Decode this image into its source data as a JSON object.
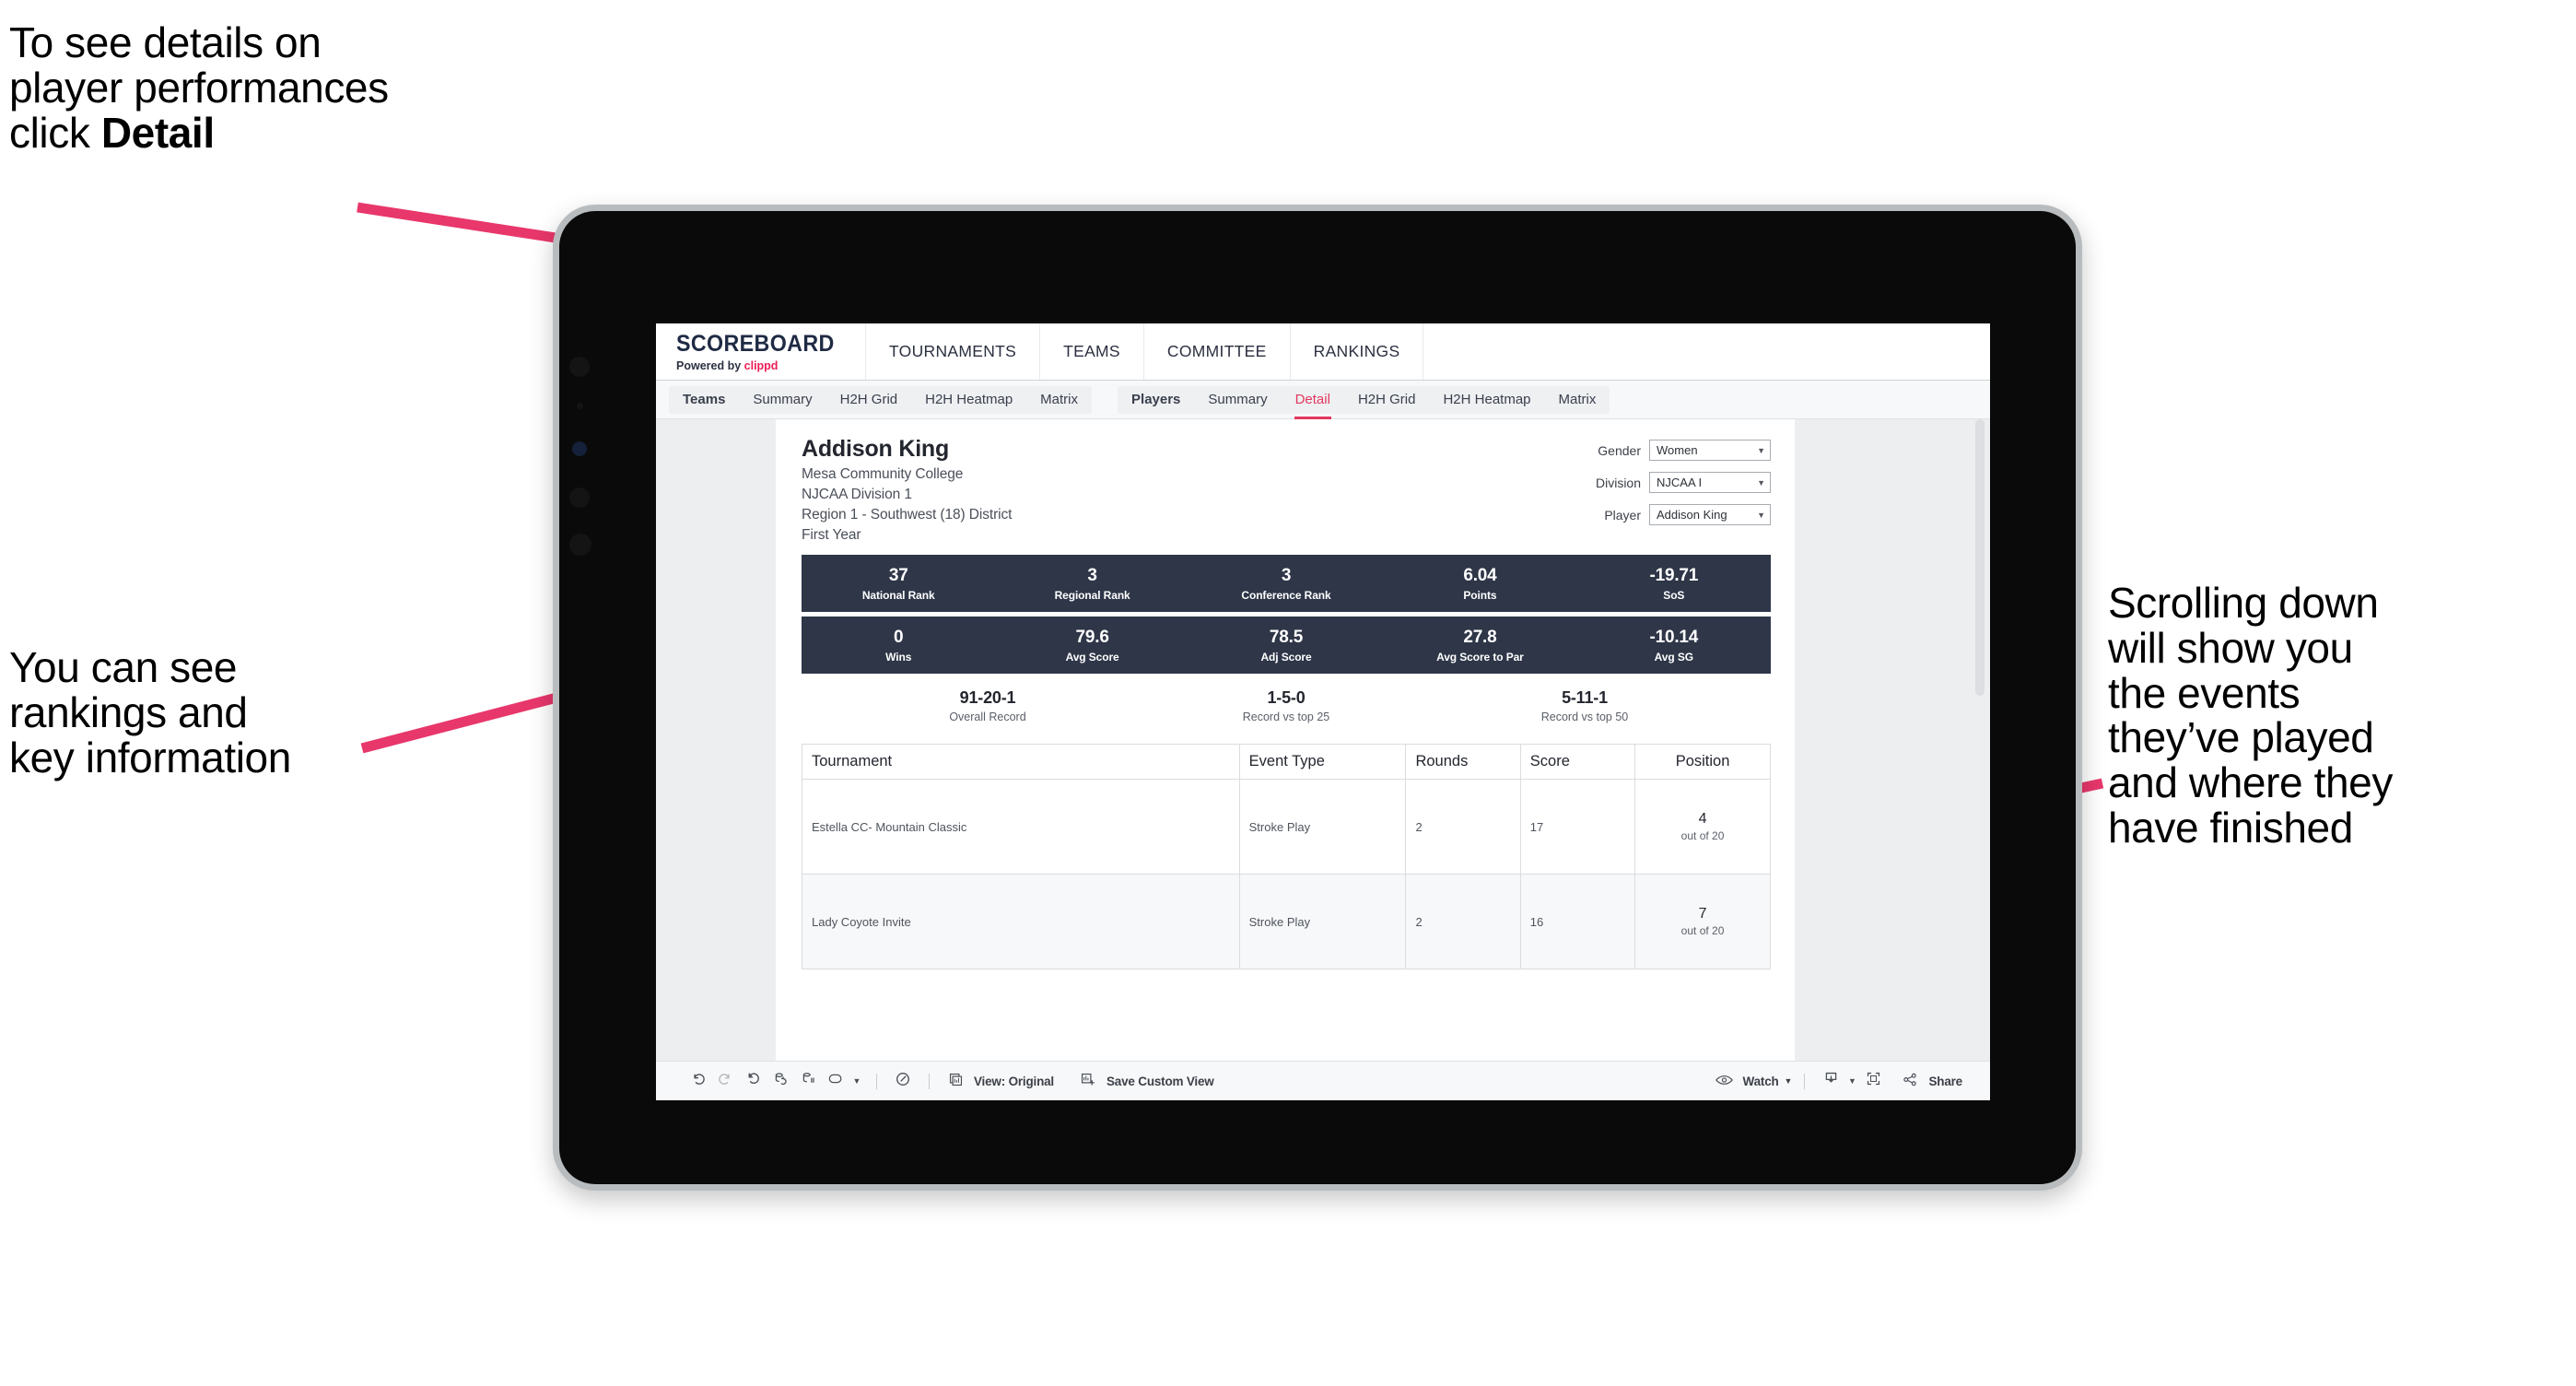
{
  "annotations": {
    "top_left": "To see details on\nplayer performances\nclick ",
    "top_left_bold": "Detail",
    "mid_left": "You can see\nrankings and\nkey information",
    "right": "Scrolling down\nwill show you\nthe events\nthey’ve played\nand where they\nhave finished"
  },
  "colors": {
    "accent_pink": "#ec1e56",
    "arrow_pink": "#e8376b",
    "stat_navy": "#2e3648",
    "active_tab": "#e3385f"
  },
  "browser": {
    "brand": {
      "name": "SCOREBOARD",
      "powered_prefix": "Powered by ",
      "powered_brand": "clippd"
    },
    "top_nav": [
      "TOURNAMENTS",
      "TEAMS",
      "COMMITTEE",
      "RANKINGS"
    ],
    "tab_group_teams": [
      "Teams",
      "Summary",
      "H2H Grid",
      "H2H Heatmap",
      "Matrix"
    ],
    "tab_group_players": [
      "Players",
      "Summary",
      "Detail",
      "H2H Grid",
      "H2H Heatmap",
      "Matrix"
    ],
    "active_tab": "Detail"
  },
  "player": {
    "name": "Addison King",
    "school": "Mesa Community College",
    "division": "NJCAA Division 1",
    "region": "Region 1 - Southwest (18) District",
    "year": "First Year"
  },
  "filters": [
    {
      "label": "Gender",
      "value": "Women"
    },
    {
      "label": "Division",
      "value": "NJCAA I"
    },
    {
      "label": "Player",
      "value": "Addison King"
    }
  ],
  "stats_row1": [
    {
      "value": "37",
      "label": "National Rank"
    },
    {
      "value": "3",
      "label": "Regional Rank"
    },
    {
      "value": "3",
      "label": "Conference Rank"
    },
    {
      "value": "6.04",
      "label": "Points"
    },
    {
      "value": "-19.71",
      "label": "SoS"
    }
  ],
  "stats_row2": [
    {
      "value": "0",
      "label": "Wins"
    },
    {
      "value": "79.6",
      "label": "Avg Score"
    },
    {
      "value": "78.5",
      "label": "Adj Score"
    },
    {
      "value": "27.8",
      "label": "Avg Score to Par"
    },
    {
      "value": "-10.14",
      "label": "Avg SG"
    }
  ],
  "records": [
    {
      "value": "91-20-1",
      "label": "Overall Record"
    },
    {
      "value": "1-5-0",
      "label": "Record vs top 25"
    },
    {
      "value": "5-11-1",
      "label": "Record vs top 50"
    }
  ],
  "table": {
    "headers": [
      "Tournament",
      "Event Type",
      "Rounds",
      "Score",
      "Position"
    ],
    "rows": [
      {
        "tournament": "Estella CC- Mountain Classic",
        "event_type": "Stroke Play",
        "rounds": "2",
        "score": "17",
        "position": "4",
        "position_sub": "out of 20"
      },
      {
        "tournament": "Lady Coyote Invite",
        "event_type": "Stroke Play",
        "rounds": "2",
        "score": "16",
        "position": "7",
        "position_sub": "out of 20"
      }
    ]
  },
  "toolbar": {
    "view_label": "View: Original",
    "save_label": "Save Custom View",
    "watch_label": "Watch",
    "share_label": "Share"
  }
}
